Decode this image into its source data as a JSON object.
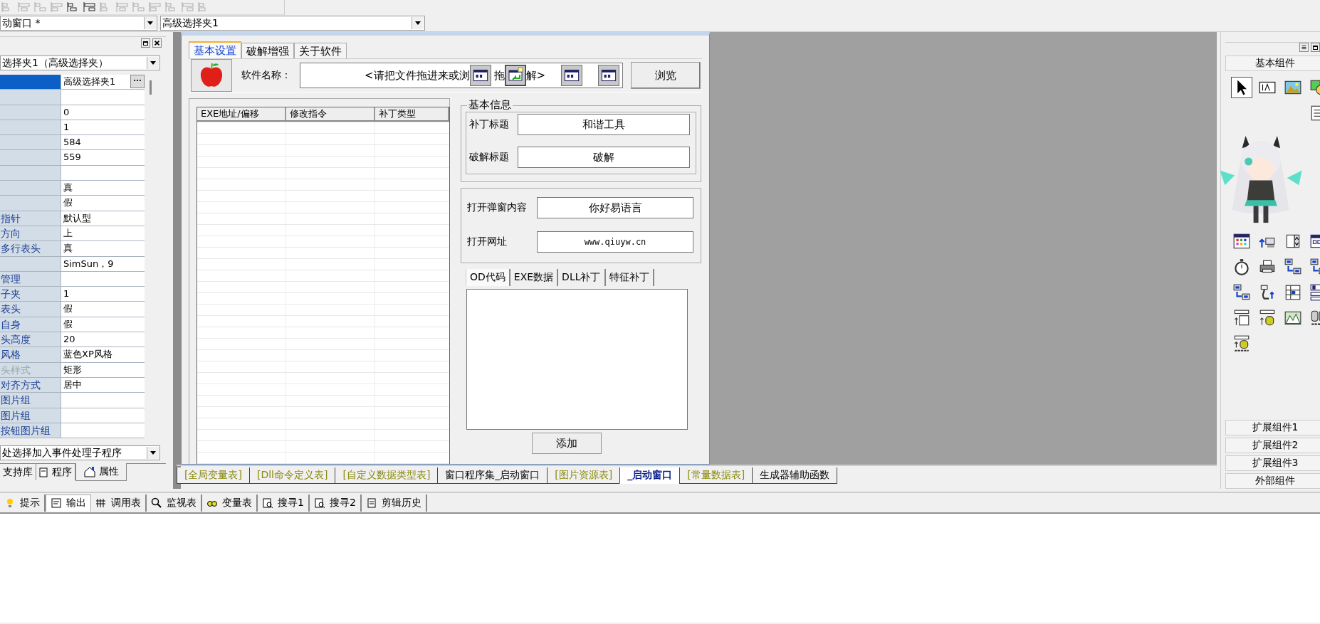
{
  "combos": [
    {
      "value": "动窗口 *"
    },
    {
      "value": "高级选择夹1"
    }
  ],
  "properties_panel": {
    "object_combo": "选择夹1（高级选择夹）",
    "value_button": "···",
    "rows": [
      {
        "value": "高级选择夹1",
        "selected": true
      },
      {
        "selected": false
      },
      {
        "value": "0",
        "selected": false
      },
      {
        "value": "1",
        "selected": false
      },
      {
        "value": "584",
        "selected": false
      },
      {
        "value": "559",
        "selected": false
      },
      {
        "selected": false
      },
      {
        "value": "真",
        "selected": false
      },
      {
        "value": "假",
        "selected": false
      },
      {
        "name": "指针",
        "value": "默认型",
        "selected": false,
        "disabled": false
      },
      {
        "name": "方向",
        "value": "上",
        "selected": false,
        "disabled": false
      },
      {
        "name": "多行表头",
        "value": "真",
        "selected": false,
        "disabled": false
      },
      {
        "value": "SimSun，9",
        "selected": false
      },
      {
        "name": "管理",
        "selected": false,
        "disabled": false
      },
      {
        "name": "子夹",
        "value": "1",
        "selected": false,
        "disabled": false
      },
      {
        "name": "表头",
        "value": "假",
        "selected": false,
        "disabled": false
      },
      {
        "name": "自身",
        "value": "假",
        "selected": false,
        "disabled": false
      },
      {
        "name": "头高度",
        "value": "20",
        "selected": false,
        "disabled": false
      },
      {
        "name": "风格",
        "value": "蓝色XP风格",
        "selected": false,
        "disabled": false
      },
      {
        "name": "头样式",
        "value": "矩形",
        "selected": false,
        "disabled": true
      },
      {
        "name": "对齐方式",
        "value": "居中",
        "selected": false,
        "disabled": false
      },
      {
        "name": "图片组",
        "selected": false,
        "disabled": false
      },
      {
        "name": "图片组",
        "selected": false,
        "disabled": false
      },
      {
        "name": "按钮图片组",
        "selected": false,
        "disabled": false
      }
    ],
    "event_combo": "处选择加入事件处理子程序",
    "tabs": [
      {
        "label": "支持库",
        "selected": false
      },
      {
        "label": "程序",
        "selected": false
      },
      {
        "label": "属性",
        "selected": true
      }
    ]
  },
  "form": {
    "tabs": [
      {
        "label": "基本设置",
        "selected": true
      },
      {
        "label": "破解增强",
        "selected": false
      },
      {
        "label": "关于软件",
        "selected": false
      }
    ],
    "file_label": "软件名称：",
    "file_field_parts": [
      "<请把文件拖进来或浏",
      "拖",
      "解>"
    ],
    "browse_button": "浏览",
    "list_columns": [
      "EXE地址/偏移",
      "修改指令",
      "补丁类型"
    ],
    "info_group": {
      "title": "基本信息",
      "fields": [
        {
          "label": "补丁标题",
          "value": "和谐工具"
        },
        {
          "label": "破解标题",
          "value": "破解"
        }
      ]
    },
    "popup_fields": [
      {
        "label": "打开弹窗内容",
        "value": "你好易语言"
      },
      {
        "label": "打开网址",
        "value": "www.qiuyw.cn"
      }
    ],
    "patch_tabs": [
      {
        "label": "OD代码",
        "selected": true
      },
      {
        "label": "EXE数据",
        "selected": false
      },
      {
        "label": "DLL补丁",
        "selected": false
      },
      {
        "label": "特征补丁",
        "selected": false
      }
    ],
    "add_button": "添加"
  },
  "code_tabs": [
    {
      "label": "[全局变量表]",
      "kind": "resource",
      "selected": false
    },
    {
      "label": "[Dll命令定义表]",
      "kind": "resource",
      "selected": false
    },
    {
      "label": "[自定义数据类型表]",
      "kind": "resource",
      "selected": false
    },
    {
      "label": "窗口程序集_启动窗口",
      "kind": "code",
      "selected": false
    },
    {
      "label": "[图片资源表]",
      "kind": "resource",
      "selected": false
    },
    {
      "label": "_启动窗口",
      "kind": "code",
      "selected": true
    },
    {
      "label": "[常量数据表]",
      "kind": "resource",
      "selected": false
    },
    {
      "label": "生成器辅助函数",
      "kind": "code",
      "selected": false
    }
  ],
  "palette": {
    "header": "基本组件",
    "footers": [
      "扩展组件1",
      "扩展组件2",
      "扩展组件3",
      "外部组件"
    ]
  },
  "output_tabs": [
    {
      "label": "提示",
      "selected": false
    },
    {
      "label": "输出",
      "selected": true
    },
    {
      "label": "调用表",
      "selected": false
    },
    {
      "label": "监视表",
      "selected": false
    },
    {
      "label": "变量表",
      "selected": false
    },
    {
      "label": "搜寻1",
      "selected": false
    },
    {
      "label": "搜寻2",
      "selected": false
    },
    {
      "label": "剪辑历史",
      "selected": false
    }
  ]
}
